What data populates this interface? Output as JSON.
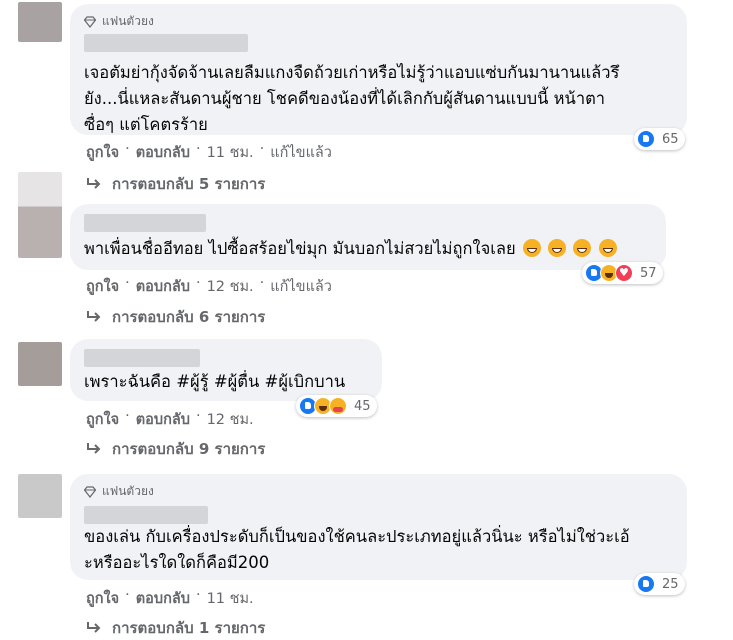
{
  "comments": [
    {
      "badge": "แฟนตัวยง",
      "lines": [
        "เจอตัมย่ากุ้งจัดจ้านเลยลืมแกงจืดถ้วยเก่าหรือไม่รู้ว่าแอบแซ่บกันมานานแล้วรึ",
        "ยัง...นี่แหละสันดานผู้ชาย โชคดีของน้องที่ได้เลิกกับผู้สันดานแบบนี้ หน้าตา",
        "ซื่อๆ แต่โคตรร้าย"
      ],
      "reaction_count": "65",
      "like": "ถูกใจ",
      "reply": "ตอบกลับ",
      "time": "11 ชม.",
      "edited": "แก้ไขแล้ว",
      "replies": "การตอบกลับ 5 รายการ"
    },
    {
      "lines": [
        "พาเพื่อนชื่ออีทอย ไปซื้อสร้อยไข่มุก มันบอกไม่สวยไม่ถูกใจเลย"
      ],
      "reaction_count": "57",
      "like": "ถูกใจ",
      "reply": "ตอบกลับ",
      "time": "12 ชม.",
      "edited": "แก้ไขแล้ว",
      "replies": "การตอบกลับ 6 รายการ"
    },
    {
      "lines": [
        "เพราะฉันคือ #ผู้รู้ #ผู้ตื่น #ผู้เบิกบาน"
      ],
      "reaction_count": "45",
      "like": "ถูกใจ",
      "reply": "ตอบกลับ",
      "time": "12 ชม.",
      "replies": "การตอบกลับ 9 รายการ"
    },
    {
      "badge": "แฟนตัวยง",
      "lines": [
        "ของเล่น กับเครื่องประดับก็เป็นของใช้คนละประเภทอยู่แล้วนิ่นะ หรือไม่ใช่วะเอ้",
        "ะหรืออะไรใดใดก็คือมี200"
      ],
      "reaction_count": "25",
      "like": "ถูกใจ",
      "reply": "ตอบกลับ",
      "time": "11 ชม.",
      "replies": "การตอบกลับ 1 รายการ"
    }
  ],
  "colors": {
    "bubble": "#f0f2f5",
    "secondary_text": "#65676b",
    "like_blue": "#1877f2",
    "haha_yellow": "#f7b125",
    "love_red": "#f33e58"
  }
}
